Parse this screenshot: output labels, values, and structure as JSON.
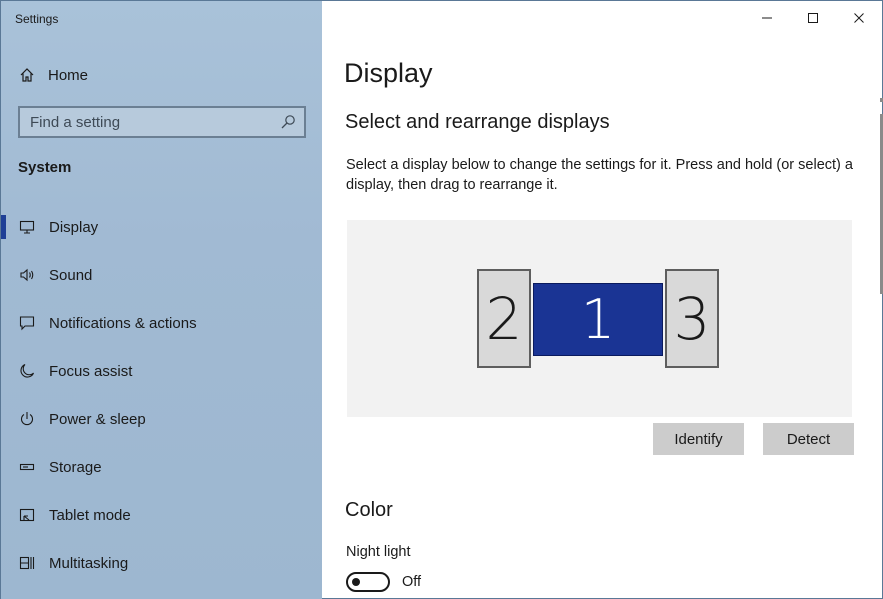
{
  "window": {
    "title": "Settings"
  },
  "sidebar": {
    "home_label": "Home",
    "search_placeholder": "Find a setting",
    "section": "System",
    "items": [
      {
        "label": "Display",
        "icon": "monitor-icon",
        "active": true
      },
      {
        "label": "Sound",
        "icon": "speaker-icon"
      },
      {
        "label": "Notifications & actions",
        "icon": "notification-icon"
      },
      {
        "label": "Focus assist",
        "icon": "moon-icon"
      },
      {
        "label": "Power & sleep",
        "icon": "power-icon"
      },
      {
        "label": "Storage",
        "icon": "storage-icon"
      },
      {
        "label": "Tablet mode",
        "icon": "tablet-icon"
      },
      {
        "label": "Multitasking",
        "icon": "multitasking-icon"
      }
    ]
  },
  "main": {
    "title": "Display",
    "arrange_heading": "Select and rearrange displays",
    "arrange_description": "Select a display below to change the settings for it. Press and hold (or select) a display, then drag to rearrange it.",
    "displays": [
      "2",
      "1",
      "3"
    ],
    "identify_label": "Identify",
    "detect_label": "Detect",
    "color_heading": "Color",
    "night_light_label": "Night light",
    "night_light_state": "Off"
  },
  "colors": {
    "accent": "#1f3f96",
    "selected_display": "#1a3494"
  }
}
